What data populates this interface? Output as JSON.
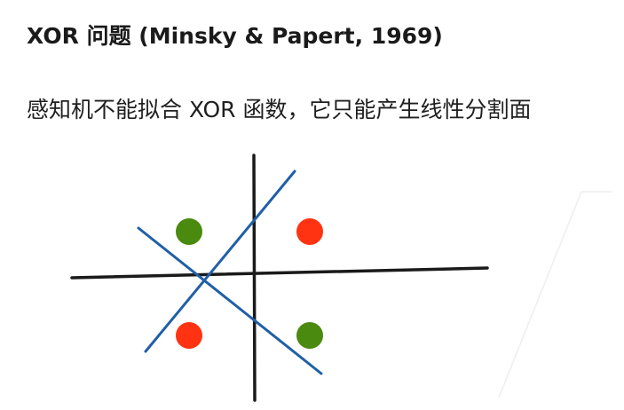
{
  "slide": {
    "title": "XOR 问题 (Minsky & Papert, 1969)",
    "subtitle": "感知机不能拟合 XOR 函数，它只能产生线性分割面"
  },
  "diagram": {
    "colors": {
      "axis": "#1a1a1a",
      "separator": "#1f5fa8",
      "class_positive": "#4a8a0f",
      "class_negative": "#ff3311",
      "background_guide": "#eeeeee"
    },
    "points": [
      {
        "quadrant": "top-left",
        "class": "positive"
      },
      {
        "quadrant": "top-right",
        "class": "negative"
      },
      {
        "quadrant": "bottom-left",
        "class": "negative"
      },
      {
        "quadrant": "bottom-right",
        "class": "positive"
      }
    ]
  }
}
